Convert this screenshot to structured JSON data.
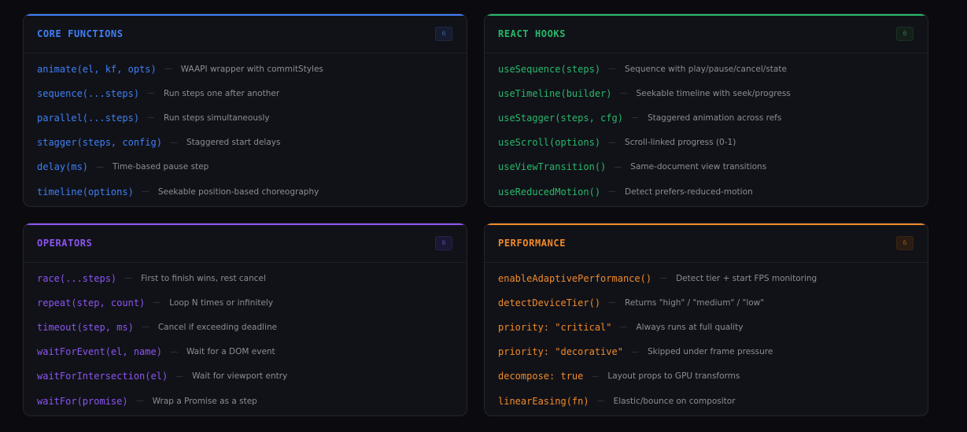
{
  "cards": [
    {
      "title": "CORE FUNCTIONS",
      "count": "6",
      "accent": "#3f7ff5",
      "badge": {
        "bg": "#161c30",
        "border": "#1f2845",
        "fg": "#3a5fa8"
      },
      "items": [
        {
          "fn": "animate(el, kf, opts)",
          "desc": "WAAPI wrapper with commitStyles"
        },
        {
          "fn": "sequence(...steps)",
          "desc": "Run steps one after another"
        },
        {
          "fn": "parallel(...steps)",
          "desc": "Run steps simultaneously"
        },
        {
          "fn": "stagger(steps, config)",
          "desc": "Staggered start delays"
        },
        {
          "fn": "delay(ms)",
          "desc": "Time-based pause step"
        },
        {
          "fn": "timeline(options)",
          "desc": "Seekable position-based choreography"
        }
      ]
    },
    {
      "title": "REACT HOOKS",
      "count": "6",
      "accent": "#28b86a",
      "badge": {
        "bg": "#13201a",
        "border": "#1b3024",
        "fg": "#2a7a4c"
      },
      "items": [
        {
          "fn": "useSequence(steps)",
          "desc": "Sequence with play/pause/cancel/state"
        },
        {
          "fn": "useTimeline(builder)",
          "desc": "Seekable timeline with seek/progress"
        },
        {
          "fn": "useStagger(steps, cfg)",
          "desc": "Staggered animation across refs"
        },
        {
          "fn": "useScroll(options)",
          "desc": "Scroll-linked progress (0-1)"
        },
        {
          "fn": "useViewTransition()",
          "desc": "Same-document view transitions"
        },
        {
          "fn": "useReducedMotion()",
          "desc": "Detect prefers-reduced-motion"
        }
      ]
    },
    {
      "title": "OPERATORS",
      "count": "6",
      "accent": "#8b55f0",
      "badge": {
        "bg": "#1a1733",
        "border": "#26214a",
        "fg": "#5c47a8"
      },
      "items": [
        {
          "fn": "race(...steps)",
          "desc": "First to finish wins, rest cancel"
        },
        {
          "fn": "repeat(step, count)",
          "desc": "Loop N times or infinitely"
        },
        {
          "fn": "timeout(step, ms)",
          "desc": "Cancel if exceeding deadline"
        },
        {
          "fn": "waitForEvent(el, name)",
          "desc": "Wait for a DOM event"
        },
        {
          "fn": "waitForIntersection(el)",
          "desc": "Wait for viewport entry"
        },
        {
          "fn": "waitFor(promise)",
          "desc": "Wrap a Promise as a step"
        }
      ]
    },
    {
      "title": "PERFORMANCE",
      "count": "6",
      "accent": "#f08a2a",
      "badge": {
        "bg": "#2a1c12",
        "border": "#3a2616",
        "fg": "#9a5a22"
      },
      "items": [
        {
          "fn": "enableAdaptivePerformance()",
          "desc": "Detect tier + start FPS monitoring"
        },
        {
          "fn": "detectDeviceTier()",
          "desc": "Returns \"high\" / \"medium\" / \"low\""
        },
        {
          "fn": "priority: \"critical\"",
          "desc": "Always runs at full quality"
        },
        {
          "fn": "priority: \"decorative\"",
          "desc": "Skipped under frame pressure"
        },
        {
          "fn": "decompose: true",
          "desc": "Layout props to GPU transforms"
        },
        {
          "fn": "linearEasing(fn)",
          "desc": "Elastic/bounce on compositor"
        }
      ]
    }
  ]
}
